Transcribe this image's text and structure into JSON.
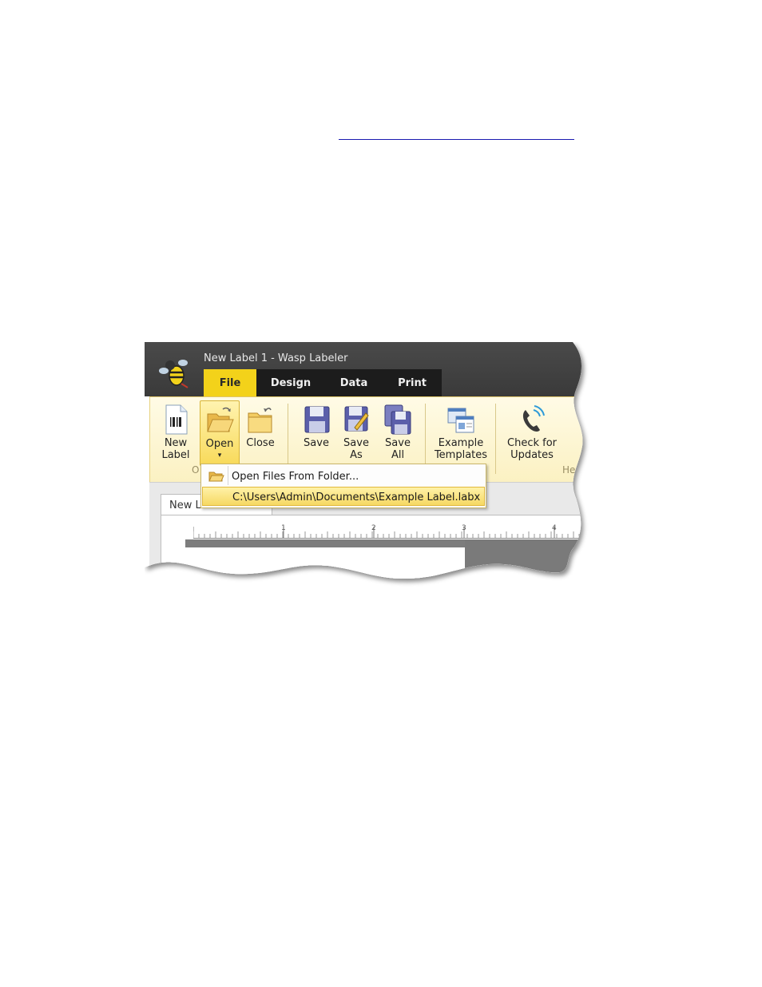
{
  "app": {
    "title": "New Label 1 - Wasp Labeler",
    "logo_icon": "wasp-logo-icon"
  },
  "tabs": [
    {
      "label": "File",
      "active": true
    },
    {
      "label": "Design",
      "active": false
    },
    {
      "label": "Data",
      "active": false
    },
    {
      "label": "Print",
      "active": false
    }
  ],
  "ribbon": {
    "buttons": [
      {
        "line1": "New",
        "line2": "Label",
        "icon": "new-label-icon"
      },
      {
        "line1": "Open",
        "line2": "▾",
        "icon": "open-folder-icon"
      },
      {
        "line1": "Close",
        "line2": "",
        "icon": "close-folder-icon"
      },
      {
        "line1": "Save",
        "line2": "",
        "icon": "save-icon"
      },
      {
        "line1": "Save",
        "line2": "As",
        "icon": "save-as-icon"
      },
      {
        "line1": "Save",
        "line2": "All",
        "icon": "save-all-icon"
      },
      {
        "line1": "Example",
        "line2": "Templates",
        "icon": "templates-icon"
      },
      {
        "line1": "Check for",
        "line2": "Updates",
        "icon": "phone-update-icon"
      }
    ],
    "group_labels": [
      "O",
      "He"
    ]
  },
  "dropdown": {
    "items": [
      {
        "label": "Open Files From Folder...",
        "icon": "folder-icon"
      },
      {
        "label": "C:\\Users\\Admin\\Documents\\Example Label.labx"
      }
    ]
  },
  "document": {
    "tab_label": "New L",
    "ruler_numbers": [
      "1",
      "2",
      "3",
      "4"
    ]
  },
  "colors": {
    "accent": "#f3d21a",
    "titlebar": "#3f3f3f",
    "ribbon": "#fdf5d2"
  }
}
